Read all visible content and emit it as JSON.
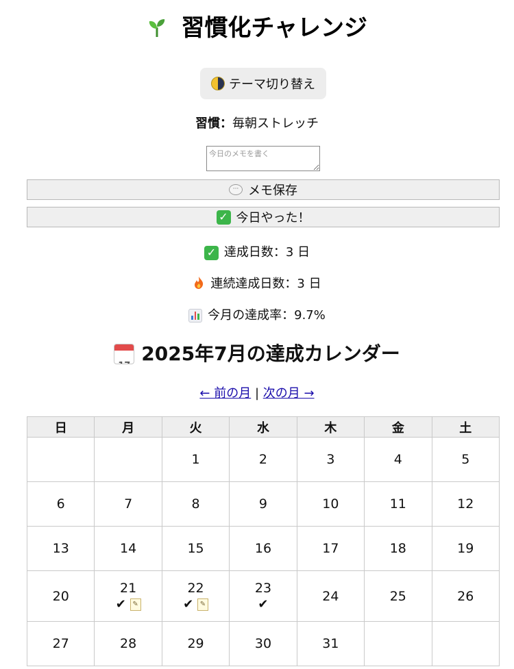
{
  "app": {
    "title": "習慣化チャレンジ",
    "title_icon": "sprout-icon"
  },
  "theme_button": {
    "label": "テーマ切り替え",
    "icon": "moon-icon"
  },
  "habit": {
    "label": "習慣：",
    "value": "毎朝ストレッチ"
  },
  "memo": {
    "placeholder": "今日のメモを書く",
    "value": ""
  },
  "save_button": {
    "label": "メモ保存",
    "icon": "speech-bubble-icon"
  },
  "done_button": {
    "label": "今日やった！",
    "icon": "check-mark-icon",
    "icon_glyph": "✓"
  },
  "stats": {
    "achieved_days": "達成日数：3 日",
    "streak_days": "連続達成日数：3 日",
    "monthly_rate": "今月の達成率：9.7%"
  },
  "calendar": {
    "title": "2025年7月の達成カレンダー",
    "icon_number": "17",
    "nav": {
      "prev": "← 前の月",
      "separator": " | ",
      "next": "次の月 →"
    },
    "weekdays": [
      "日",
      "月",
      "火",
      "水",
      "木",
      "金",
      "土"
    ],
    "weeks": [
      [
        {
          "d": ""
        },
        {
          "d": ""
        },
        {
          "d": "1"
        },
        {
          "d": "2"
        },
        {
          "d": "3"
        },
        {
          "d": "4"
        },
        {
          "d": "5"
        }
      ],
      [
        {
          "d": "6"
        },
        {
          "d": "7"
        },
        {
          "d": "8"
        },
        {
          "d": "9"
        },
        {
          "d": "10"
        },
        {
          "d": "11"
        },
        {
          "d": "12"
        }
      ],
      [
        {
          "d": "13"
        },
        {
          "d": "14"
        },
        {
          "d": "15"
        },
        {
          "d": "16"
        },
        {
          "d": "17"
        },
        {
          "d": "18"
        },
        {
          "d": "19"
        }
      ],
      [
        {
          "d": "20"
        },
        {
          "d": "21",
          "done": true,
          "memo": true
        },
        {
          "d": "22",
          "done": true,
          "memo": true
        },
        {
          "d": "23",
          "done": true
        },
        {
          "d": "24"
        },
        {
          "d": "25"
        },
        {
          "d": "26"
        }
      ],
      [
        {
          "d": "27"
        },
        {
          "d": "28"
        },
        {
          "d": "29"
        },
        {
          "d": "30"
        },
        {
          "d": "31"
        },
        {
          "d": ""
        },
        {
          "d": ""
        }
      ]
    ],
    "done_mark": "✔"
  },
  "colors": {
    "background": "#ffffff",
    "button_bg": "#efefef",
    "link": "#1a0dab",
    "check_green": "#3cb54a"
  }
}
